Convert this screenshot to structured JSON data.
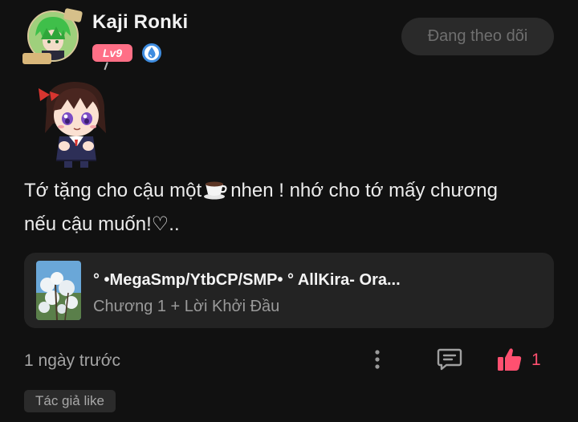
{
  "user": {
    "name": "Kaji Ronki",
    "level": "Lv9",
    "follow_label": "Đang theo dõi"
  },
  "comment": {
    "text_before_icon": "Tớ tặng cho cậu một",
    "inline_icon": "coffee-cup-icon",
    "text_after_icon": "nhen ! nhớ cho tớ mấy chương",
    "text_line2": "nếu cậu muốn!♡.."
  },
  "chapter_card": {
    "title": "° •MegaSmp/YtbCP/SMP• ° AllKira- Ora...",
    "subtitle": "Chương 1 + Lời Khởi Đầu"
  },
  "footer": {
    "time": "1 ngày trước",
    "like_count": "1",
    "author_like_badge": "Tác giả like"
  },
  "colors": {
    "background": "#111111",
    "card": "#232323",
    "level_badge": "#ff6f86",
    "like_accent": "#ff5070",
    "verify_badge": "#3f8de0"
  }
}
